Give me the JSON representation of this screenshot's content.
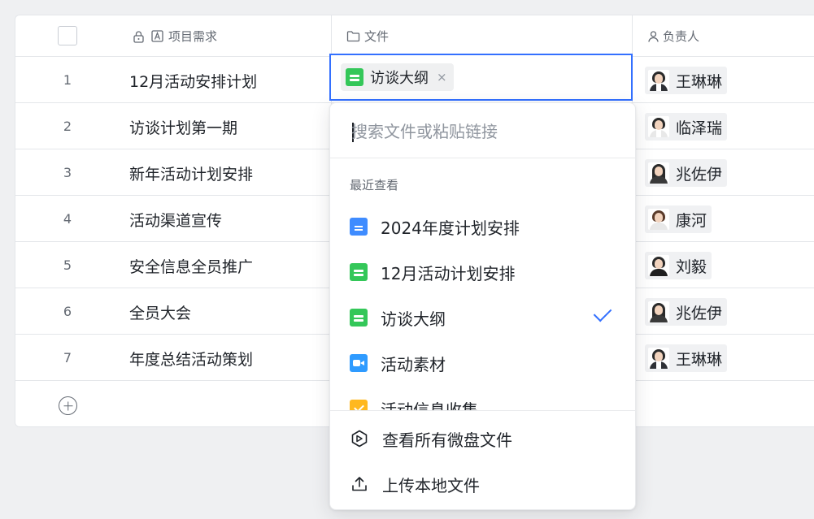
{
  "header": {
    "col_name": "项目需求",
    "col_file": "文件",
    "col_owner": "负责人"
  },
  "rows": [
    {
      "num": "1",
      "name": "12月活动安排计划",
      "owner": "王琳琳"
    },
    {
      "num": "2",
      "name": "访谈计划第一期",
      "owner": "临泽瑞"
    },
    {
      "num": "3",
      "name": "新年活动计划安排",
      "owner": "兆佐伊"
    },
    {
      "num": "4",
      "name": "活动渠道宣传",
      "owner": "康河"
    },
    {
      "num": "5",
      "name": "安全信息全员推广",
      "owner": "刘毅"
    },
    {
      "num": "6",
      "name": "全员大会",
      "owner": "兆佐伊"
    },
    {
      "num": "7",
      "name": "年度总结活动策划",
      "owner": "王琳琳"
    }
  ],
  "active_cell": {
    "chip_label": "访谈大纲",
    "remove_symbol": "×"
  },
  "dropdown": {
    "search_placeholder": "搜索文件或粘贴链接",
    "recent_title": "最近查看",
    "items": [
      {
        "label": "2024年度计划安排",
        "icon": "doc-icon"
      },
      {
        "label": "12月活动计划安排",
        "icon": "sheet-icon"
      },
      {
        "label": "访谈大纲",
        "icon": "sheet-icon",
        "selected": true
      },
      {
        "label": "活动素材",
        "icon": "video-icon"
      },
      {
        "label": "活动信息收集",
        "icon": "form-icon"
      }
    ],
    "view_all": "查看所有微盘文件",
    "upload": "上传本地文件"
  },
  "colors": {
    "accent": "#3370ff",
    "sheet_green": "#34c759",
    "doc_blue": "#3f8cff"
  }
}
